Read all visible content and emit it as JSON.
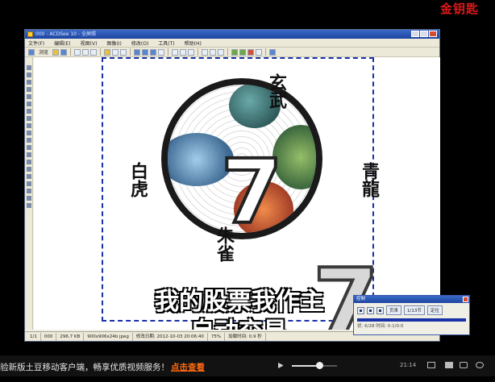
{
  "brand": {
    "text": "金钥匙"
  },
  "app_window": {
    "title": "000 - ACDSee 10 - 全屏照",
    "menu": [
      "文件(F)",
      "编辑(E)",
      "视图(V)",
      "图像(I)",
      "修改(O)",
      "工具(T)",
      "帮助(H)"
    ],
    "toolbar_browse_label": "浏览"
  },
  "canvas": {
    "calligraphy": {
      "xuanwu": "玄武",
      "qinglong": "青龍",
      "baihu": "白虎",
      "zhuque": "朱雀"
    },
    "big_number": "7",
    "slogan_line1": "我的股票我作主",
    "slogan_line2": "自动交易"
  },
  "status_bar": [
    "1/1",
    "000",
    "296.7 KB",
    "900x906x24b jpeg",
    "修改日期: 2012-10-03 20:06:40",
    "75%",
    "加载时间: 0.9 秒"
  ],
  "recorder": {
    "title": "控制",
    "btn_prev_label": "页来",
    "btn_page_label": "1/13节",
    "btn_locate_label": "定位",
    "status_text": "状: 6/28 时间: 0:1/0:0"
  },
  "player_bar": {
    "marquee_text": "验新版土豆移动客户端，畅享优质视频服务！",
    "marquee_link": "点击查看",
    "volume_level": 0.6,
    "clock": "21:14"
  },
  "colors": {
    "selection_border": "#1830a8",
    "marquee_link": "#ff6a10",
    "brand": "#e01818"
  }
}
